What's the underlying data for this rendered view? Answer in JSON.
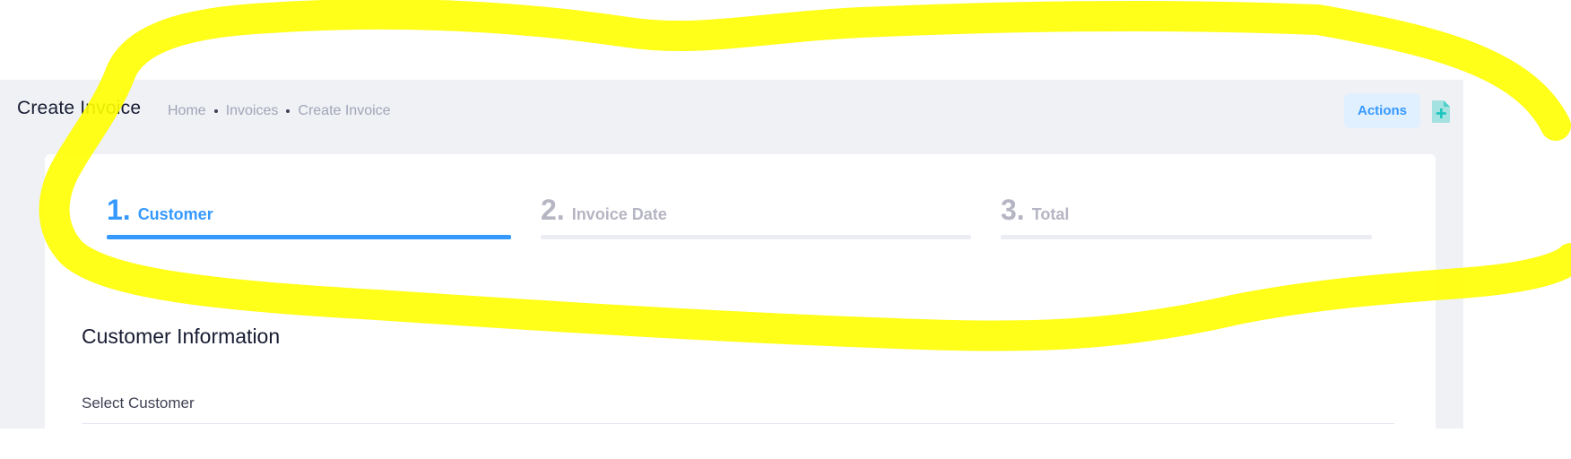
{
  "subheader": {
    "title": "Create Invoice",
    "breadcrumb": [
      "Home",
      "Invoices",
      "Create Invoice"
    ],
    "actions_label": "Actions",
    "add_icon": "add-document-icon"
  },
  "wizard": {
    "active_step": 1,
    "steps": [
      {
        "number": "1.",
        "label": "Customer"
      },
      {
        "number": "2.",
        "label": "Invoice Date"
      },
      {
        "number": "3.",
        "label": "Total"
      }
    ]
  },
  "form": {
    "section_title": "Customer Information",
    "select_label": "Select Customer"
  },
  "colors": {
    "primary": "#3699ff",
    "primary_light": "#e1f0ff",
    "success": "#1bc5bd",
    "annotation": "#ffff00",
    "page_bg": "#eff1f5"
  }
}
